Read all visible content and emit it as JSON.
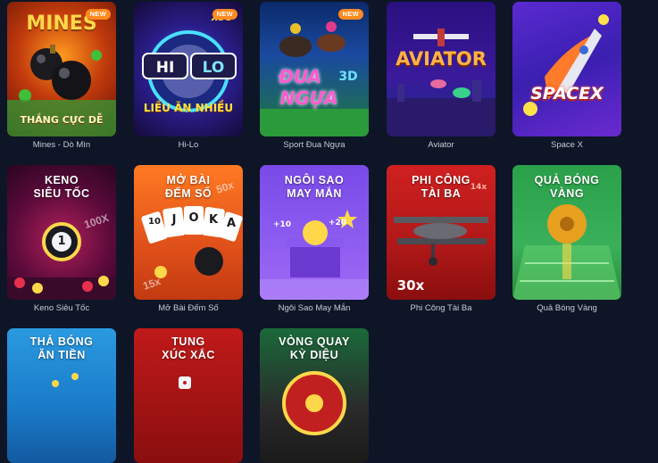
{
  "badge_new": "NEW",
  "games": [
    {
      "id": "mines",
      "label": "Mines - Dò Mìn",
      "title": "MINES",
      "subtitle": "THẮNG CỰC DỄ",
      "is_new": true
    },
    {
      "id": "hilo",
      "label": "Hi-Lo",
      "title_left": "HI",
      "title_right": "LO",
      "subtitle": "LIỀU ĂN NHIỀU",
      "multiplier": "x99",
      "is_new": true
    },
    {
      "id": "sport-dua-ngua",
      "label": "Sport Đua Ngựa",
      "title_a": "ĐUA",
      "title_b": "NGỰA",
      "title_3d": "3D",
      "is_new": true
    },
    {
      "id": "aviator",
      "label": "Aviator",
      "title": "AVIATOR"
    },
    {
      "id": "spacex",
      "label": "Space X",
      "title": "SPACEX"
    },
    {
      "id": "keno",
      "label": "Keno Siêu Tốc",
      "caption": [
        "KENO",
        "SIÊU TỐC"
      ],
      "ball_number": "1",
      "multiplier": "100X"
    },
    {
      "id": "mo-bai",
      "label": "Mở Bài Đếm Số",
      "caption": [
        "MỞ BÀI",
        "ĐẾM SỐ"
      ],
      "card_letters": [
        "10",
        "J",
        "O",
        "K",
        "A"
      ],
      "multiplier_a": "50x",
      "multiplier_b": "15x"
    },
    {
      "id": "ngoi-sao",
      "label": "Ngôi Sao May Mắn",
      "caption": [
        "NGÔI SAO",
        "MAY MẮN"
      ],
      "bonus_a": "+10",
      "bonus_b": "+20"
    },
    {
      "id": "phi-cong",
      "label": "Phi Công Tài Ba",
      "caption": [
        "PHI CÔNG",
        "TÀI BA"
      ],
      "multiplier_a": "14x",
      "multiplier_b": "30x"
    },
    {
      "id": "qua-bong",
      "label": "Quả Bóng Vàng",
      "caption": [
        "QUẢ BÓNG",
        "VÀNG"
      ]
    },
    {
      "id": "tha-bong",
      "label": "Thả Bóng Ăn Tiền",
      "caption": [
        "THẢ BÓNG",
        "ĂN TIỀN"
      ]
    },
    {
      "id": "tung-xuc-xac",
      "label": "Tung Xúc Xắc",
      "caption": [
        "TUNG",
        "XÚC XẮC"
      ]
    },
    {
      "id": "vong-quay",
      "label": "Vòng Quay Kỳ Diệu",
      "caption": [
        "VÒNG QUAY",
        "KỲ DIỆU"
      ]
    }
  ]
}
